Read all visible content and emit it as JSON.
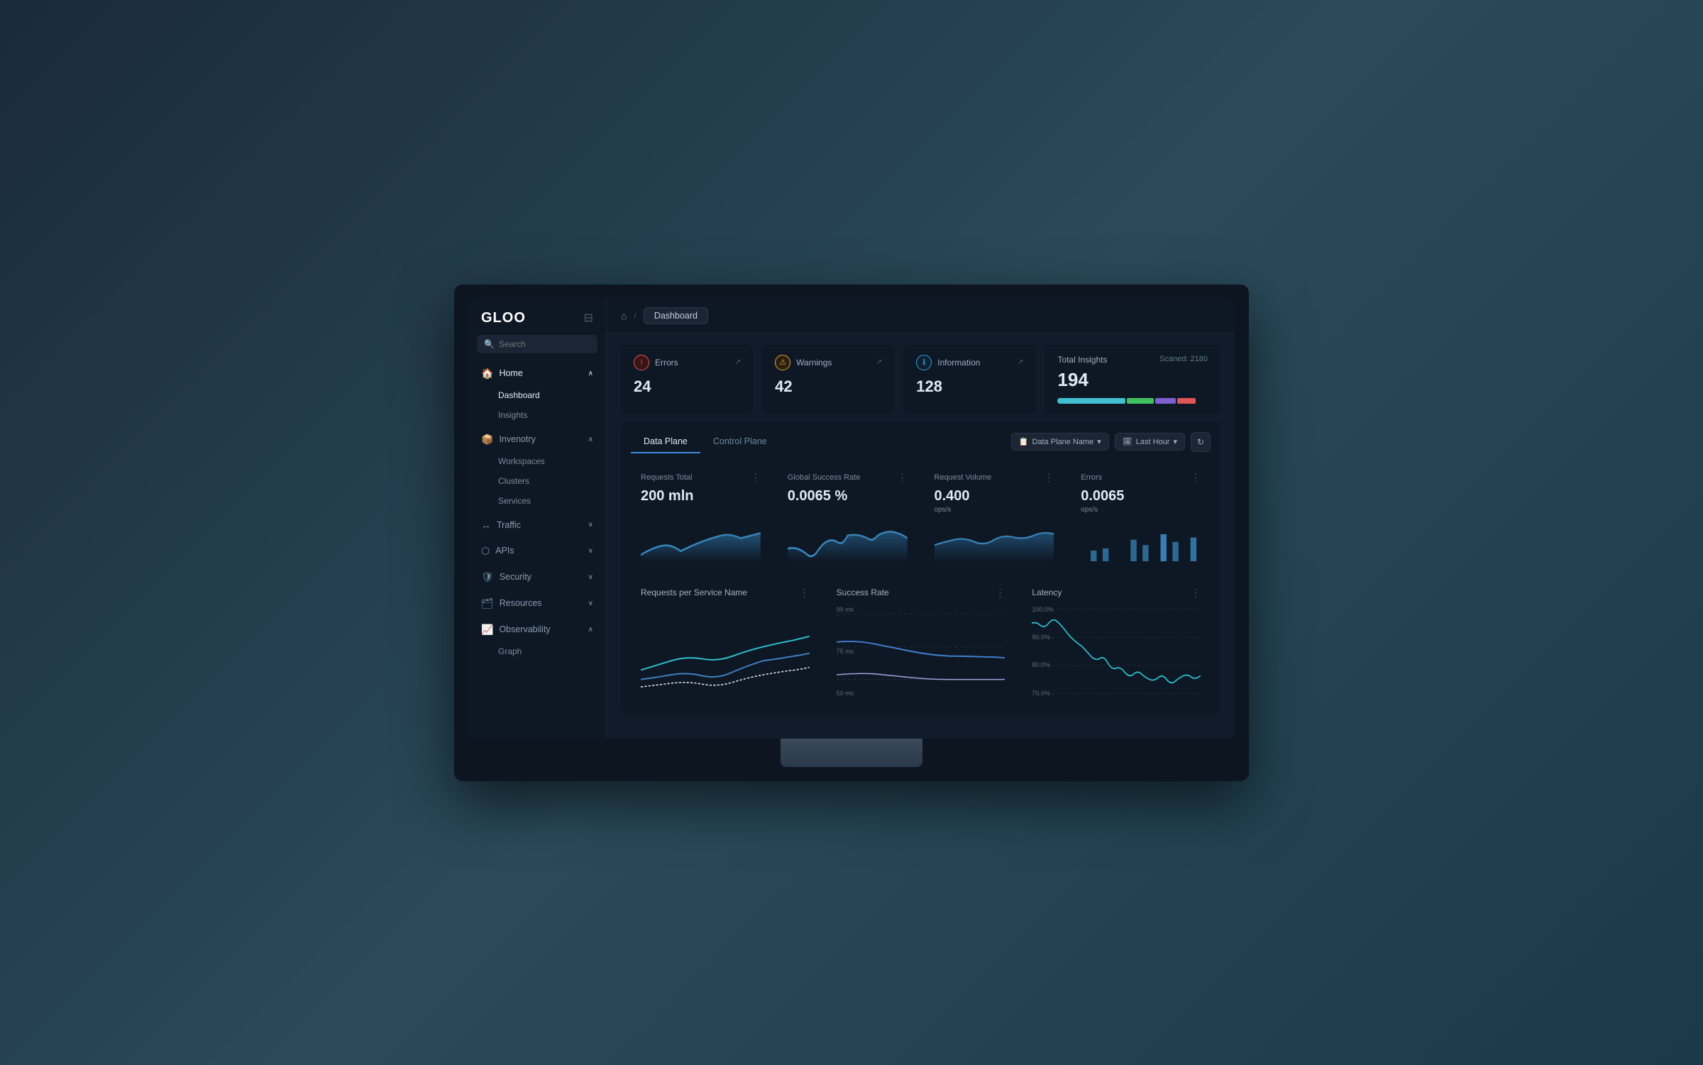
{
  "app": {
    "logo": "GLOO",
    "breadcrumb": "Dashboard"
  },
  "search": {
    "placeholder": "Search"
  },
  "sidebar": {
    "sections": [
      {
        "id": "home",
        "label": "Home",
        "icon": "🏠",
        "expanded": true,
        "children": [
          {
            "label": "Dashboard",
            "active": true
          },
          {
            "label": "Insights",
            "active": false
          }
        ]
      },
      {
        "id": "inventory",
        "label": "Invenotry",
        "icon": "📦",
        "expanded": true,
        "children": [
          {
            "label": "Workspaces",
            "active": false
          },
          {
            "label": "Clusters",
            "active": false
          },
          {
            "label": "Services",
            "active": false
          }
        ]
      },
      {
        "id": "traffic",
        "label": "Traffic",
        "icon": "↔",
        "expanded": false,
        "children": []
      },
      {
        "id": "apis",
        "label": "APIs",
        "icon": "⬡",
        "expanded": false,
        "children": []
      },
      {
        "id": "security",
        "label": "Security",
        "icon": "🛡",
        "expanded": false,
        "children": []
      },
      {
        "id": "resources",
        "label": "Resources",
        "icon": "🗂",
        "expanded": false,
        "children": []
      },
      {
        "id": "observability",
        "label": "Observability",
        "icon": "📈",
        "expanded": true,
        "children": [
          {
            "label": "Graph",
            "active": false
          }
        ]
      }
    ]
  },
  "insights": {
    "cards": [
      {
        "type": "error",
        "label": "Errors",
        "value": "24",
        "color": "#e05555"
      },
      {
        "type": "warning",
        "label": "Warnings",
        "value": "42",
        "color": "#e0a030"
      },
      {
        "type": "info",
        "label": "Information",
        "value": "128",
        "color": "#30a0e0"
      }
    ],
    "total": {
      "label": "Total Insights",
      "value": "194",
      "scanned": "Scaned: 2180",
      "bar_segments": [
        {
          "width": 45,
          "color": "#40c0d0"
        },
        {
          "width": 18,
          "color": "#40c060"
        },
        {
          "width": 14,
          "color": "#8060d0"
        },
        {
          "width": 12,
          "color": "#e05555"
        }
      ]
    }
  },
  "metrics": {
    "tabs": [
      {
        "label": "Data Plane",
        "active": true
      },
      {
        "label": "Control Plane",
        "active": false
      }
    ],
    "controls": {
      "data_plane_name": "Data Plane Name",
      "last_hour": "Last Hour",
      "refresh_icon": "↻"
    },
    "cards": [
      {
        "label": "Requests Total",
        "value": "200 mln",
        "unit": "",
        "chart_type": "area",
        "chart_color": "#2a5a8a"
      },
      {
        "label": "Global Success Rate",
        "value": "0.0065 %",
        "unit": "",
        "chart_type": "area",
        "chart_color": "#2a5a8a"
      },
      {
        "label": "Request Volume",
        "value": "0.400",
        "unit": "ops/s",
        "chart_type": "area",
        "chart_color": "#2a5a8a"
      },
      {
        "label": "Errors",
        "value": "0.0065",
        "unit": "ops/s",
        "chart_type": "bar",
        "chart_color": "#2a5a8a"
      }
    ],
    "charts": [
      {
        "title": "Requests per Service Name",
        "type": "multi-line"
      },
      {
        "title": "Success Rate",
        "type": "multi-line",
        "y_labels": [
          "99 ms",
          "75 ms",
          "50 ms"
        ]
      },
      {
        "title": "Latency",
        "type": "line",
        "y_labels": [
          "100.0%",
          "90.0%",
          "80.0%",
          "70.0%"
        ]
      }
    ]
  }
}
